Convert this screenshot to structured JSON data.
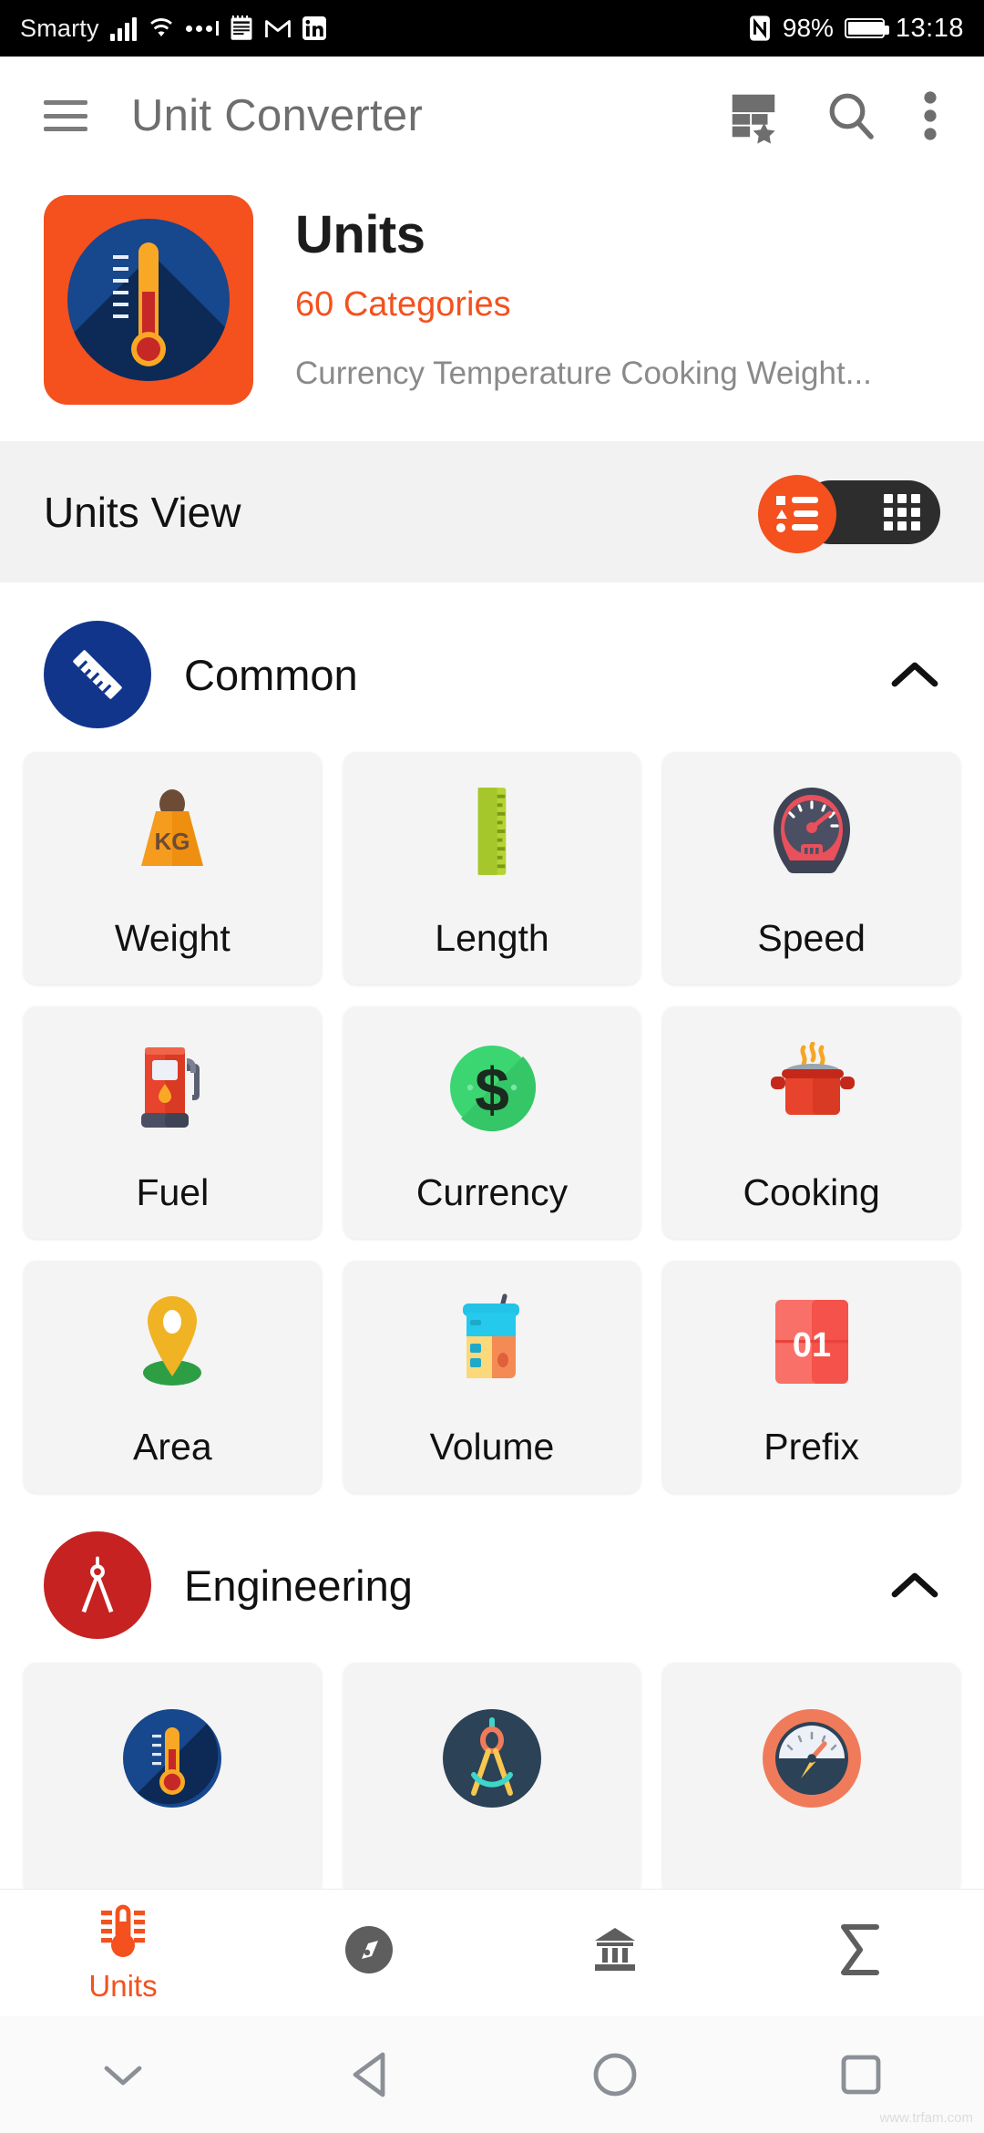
{
  "status_bar": {
    "carrier": "Smarty",
    "icons": [
      "signal-bars-icon",
      "wifi-icon",
      "more-dots-icon",
      "calendar-icon",
      "gmail-icon",
      "linkedin-icon"
    ],
    "nfc_icon": "nfc-icon",
    "battery_percent": "98%",
    "battery_level": 98,
    "time": "13:18"
  },
  "app_bar": {
    "menu_icon": "hamburger-menu-icon",
    "title": "Unit Converter",
    "favorites_icon": "table-favorite-icon",
    "search_icon": "search-icon",
    "overflow_icon": "more-vertical-icon"
  },
  "app_header": {
    "icon": "thermometer-app-icon",
    "title": "Units",
    "categories": "60 Categories",
    "description": "Currency Temperature Cooking Weight..."
  },
  "units_view": {
    "label": "Units View",
    "list_view_icon": "list-view-icon",
    "grid_view_icon": "grid-view-icon",
    "selected": "list"
  },
  "sections": [
    {
      "name": "Common",
      "badge_icon": "ruler-icon",
      "badge_color": "#12358C",
      "chevron": "chevron-up-icon",
      "expanded": true,
      "tiles": [
        {
          "label": "Weight",
          "icon": "weight-kg-icon"
        },
        {
          "label": "Length",
          "icon": "ruler-vertical-icon"
        },
        {
          "label": "Speed",
          "icon": "speedometer-icon"
        },
        {
          "label": "Fuel",
          "icon": "fuel-pump-icon"
        },
        {
          "label": "Currency",
          "icon": "dollar-coin-icon"
        },
        {
          "label": "Cooking",
          "icon": "cooking-pot-icon"
        },
        {
          "label": "Area",
          "icon": "map-pin-icon"
        },
        {
          "label": "Volume",
          "icon": "beaker-icon"
        },
        {
          "label": "Prefix",
          "icon": "number-card-icon"
        }
      ]
    },
    {
      "name": "Engineering",
      "badge_icon": "compass-divider-icon",
      "badge_color": "#C62222",
      "chevron": "chevron-up-icon",
      "expanded": true,
      "tiles": [
        {
          "label": "",
          "icon": "temperature-circle-icon"
        },
        {
          "label": "",
          "icon": "compass-circle-icon"
        },
        {
          "label": "",
          "icon": "pressure-gauge-icon"
        }
      ]
    }
  ],
  "bottom_nav": [
    {
      "label": "Units",
      "icon": "thermometer-icon",
      "active": true
    },
    {
      "label": "",
      "icon": "compass-icon",
      "active": false
    },
    {
      "label": "",
      "icon": "bank-icon",
      "active": false
    },
    {
      "label": "",
      "icon": "sigma-icon",
      "active": false
    }
  ],
  "android_nav": [
    {
      "icon": "hide-keyboard-icon"
    },
    {
      "icon": "back-icon"
    },
    {
      "icon": "home-icon"
    },
    {
      "icon": "recents-icon"
    }
  ],
  "colors": {
    "accent": "#F4511E",
    "navy": "#12358C",
    "red": "#C62222",
    "dark": "#2D2D2D",
    "band": "#F2F2F2",
    "tile": "#F4F4F4"
  },
  "watermark": "www.trfam.com"
}
